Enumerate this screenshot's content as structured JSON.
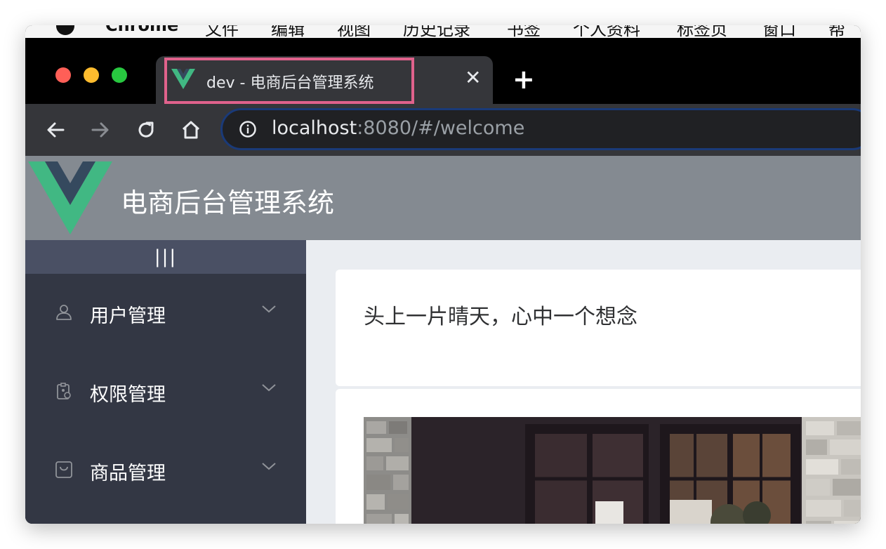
{
  "menubar": {
    "app": "Chrome",
    "items": [
      "文件",
      "编辑",
      "视图",
      "历史记录",
      "书签",
      "个人资料",
      "标签页",
      "窗口",
      "帮助"
    ]
  },
  "browser": {
    "tab": {
      "title": "dev - 电商后台管理系统",
      "favicon": "vue-logo-icon"
    },
    "url": {
      "host": "localhost",
      "rest": ":8080/#/welcome"
    },
    "highlight_color": "#e0628c"
  },
  "app": {
    "title": "电商后台管理系统",
    "toggle_label": "|||",
    "menu": [
      {
        "label": "用户管理",
        "icon": "user-icon"
      },
      {
        "label": "权限管理",
        "icon": "permission-icon"
      },
      {
        "label": "商品管理",
        "icon": "shopping-bag-icon"
      }
    ],
    "welcome_text": "头上一片晴天，心中一个想念",
    "colors": {
      "header": "#848a91",
      "sidebar": "#333744",
      "toggle": "#4a5064",
      "vue_green": "#41b883",
      "vue_dark": "#35495e"
    }
  }
}
